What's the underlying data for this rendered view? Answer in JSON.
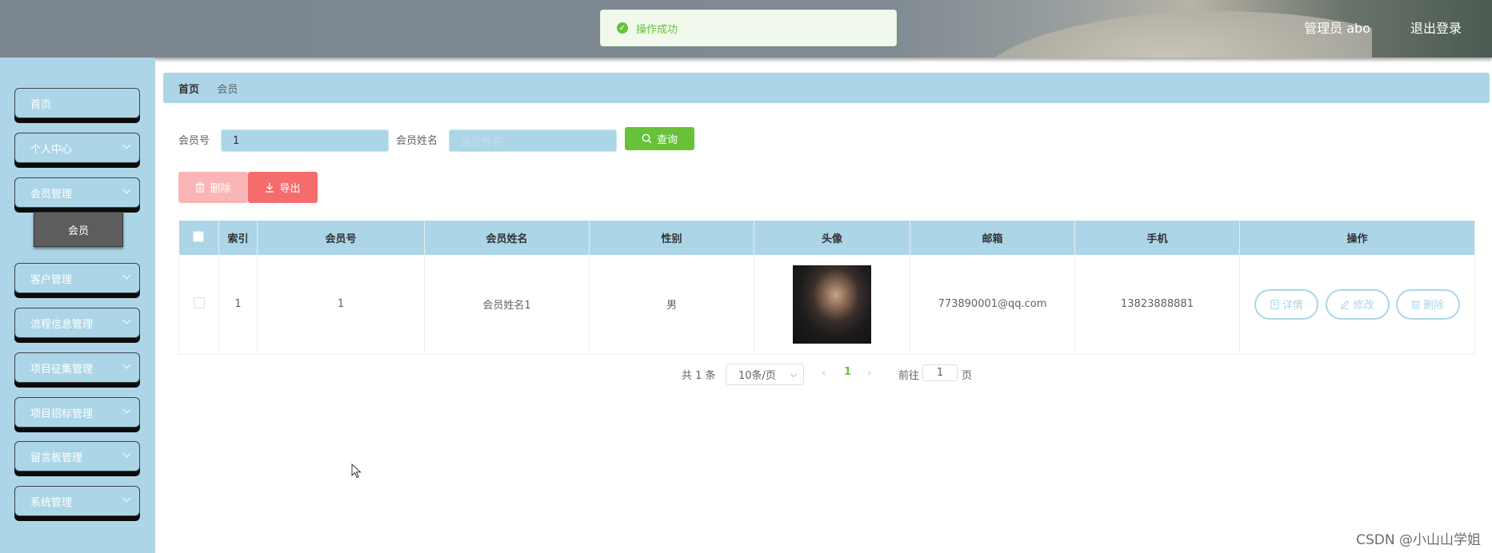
{
  "header": {
    "user_label": "管理员 abo",
    "logout_label": "退出登录"
  },
  "toast": {
    "message": "操作成功"
  },
  "sidebar": {
    "items": [
      {
        "label": "首页",
        "has_children": false
      },
      {
        "label": "个人中心",
        "has_children": true
      },
      {
        "label": "会员管理",
        "has_children": true
      },
      {
        "label": "客户管理",
        "has_children": true
      },
      {
        "label": "流程信息管理",
        "has_children": true
      },
      {
        "label": "项目征集管理",
        "has_children": true
      },
      {
        "label": "项目招标管理",
        "has_children": true
      },
      {
        "label": "留言板管理",
        "has_children": true
      },
      {
        "label": "系统管理",
        "has_children": true
      }
    ],
    "active_submenu": "会员"
  },
  "breadcrumb": {
    "home": "首页",
    "separator": "/",
    "current": "会员"
  },
  "search": {
    "member_no_label": "会员号",
    "member_no_value": "1",
    "member_name_label": "会员姓名",
    "member_name_placeholder": "会员姓名",
    "search_button": "查询"
  },
  "actions": {
    "delete_label": "删除",
    "export_label": "导出"
  },
  "table": {
    "headers": [
      "索引",
      "会员号",
      "会员姓名",
      "性别",
      "头像",
      "邮箱",
      "手机",
      "操作"
    ],
    "rows": [
      {
        "index": "1",
        "member_no": "1",
        "member_name": "会员姓名1",
        "gender": "男",
        "email": "773890001@qq.com",
        "phone": "13823888881"
      }
    ],
    "row_actions": {
      "detail": "详情",
      "edit": "修改",
      "delete": "删除"
    }
  },
  "pagination": {
    "total_text": "共 1 条",
    "page_size": "10条/页",
    "current_page": "1",
    "goto_label": "前往",
    "goto_value": "1",
    "page_suffix": "页"
  },
  "watermark": "CSDN @小山山学姐",
  "colors": {
    "accent": "#acd6e7",
    "success": "#67c23a",
    "danger": "#f56c6c",
    "danger_light": "#fab6b6"
  }
}
